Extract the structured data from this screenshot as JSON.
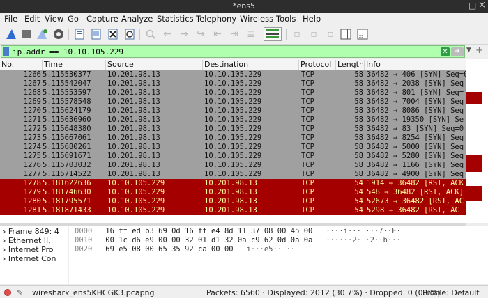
{
  "window": {
    "title": "*ens5",
    "min": "–",
    "max": "□",
    "close": "×"
  },
  "menu": [
    "File",
    "Edit",
    "View",
    "Go",
    "Capture",
    "Analyze",
    "Statistics",
    "Telephony",
    "Wireless",
    "Tools",
    "Help"
  ],
  "filter": {
    "value": "ip.addr == 10.10.105.229"
  },
  "columns": [
    "No.",
    "Time",
    "Source",
    "Destination",
    "Protocol",
    "Length",
    "Info"
  ],
  "packets": [
    {
      "no": "1266",
      "time": "5.115530377",
      "src": "10.201.98.13",
      "dst": "10.10.105.229",
      "proto": "TCP",
      "len": "58",
      "info": "36482 → 406 [SYN] Seq=0",
      "style": "gray"
    },
    {
      "no": "1267",
      "time": "5.115542047",
      "src": "10.201.98.13",
      "dst": "10.10.105.229",
      "proto": "TCP",
      "len": "58",
      "info": "36482 → 2038 [SYN] Seq",
      "style": "gray"
    },
    {
      "no": "1268",
      "time": "5.115553597",
      "src": "10.201.98.13",
      "dst": "10.10.105.229",
      "proto": "TCP",
      "len": "58",
      "info": "36482 → 801 [SYN] Seq=",
      "style": "gray"
    },
    {
      "no": "1269",
      "time": "5.115578548",
      "src": "10.201.98.13",
      "dst": "10.10.105.229",
      "proto": "TCP",
      "len": "58",
      "info": "36482 → 7004 [SYN] Seq",
      "style": "gray"
    },
    {
      "no": "1270",
      "time": "5.115624179",
      "src": "10.201.98.13",
      "dst": "10.10.105.229",
      "proto": "TCP",
      "len": "58",
      "info": "36482 → 8086 [SYN] Seq",
      "style": "gray"
    },
    {
      "no": "1271",
      "time": "5.115636960",
      "src": "10.201.98.13",
      "dst": "10.10.105.229",
      "proto": "TCP",
      "len": "58",
      "info": "36482 → 19350 [SYN] Se",
      "style": "gray"
    },
    {
      "no": "1272",
      "time": "5.115648380",
      "src": "10.201.98.13",
      "dst": "10.10.105.229",
      "proto": "TCP",
      "len": "58",
      "info": "36482 → 83 [SYN] Seq=0",
      "style": "gray"
    },
    {
      "no": "1273",
      "time": "5.115667061",
      "src": "10.201.98.13",
      "dst": "10.10.105.229",
      "proto": "TCP",
      "len": "58",
      "info": "36482 → 8254 [SYN] Seq",
      "style": "gray"
    },
    {
      "no": "1274",
      "time": "5.115680261",
      "src": "10.201.98.13",
      "dst": "10.10.105.229",
      "proto": "TCP",
      "len": "58",
      "info": "36482 → 5000 [SYN] Seq",
      "style": "gray"
    },
    {
      "no": "1275",
      "time": "5.115691671",
      "src": "10.201.98.13",
      "dst": "10.10.105.229",
      "proto": "TCP",
      "len": "58",
      "info": "36482 → 5280 [SYN] Seq",
      "style": "gray"
    },
    {
      "no": "1276",
      "time": "5.115703032",
      "src": "10.201.98.13",
      "dst": "10.10.105.229",
      "proto": "TCP",
      "len": "58",
      "info": "36482 → 1166 [SYN] Seq",
      "style": "gray"
    },
    {
      "no": "1277",
      "time": "5.115714522",
      "src": "10.201.98.13",
      "dst": "10.10.105.229",
      "proto": "TCP",
      "len": "58",
      "info": "36482 → 4900 [SYN] Seq",
      "style": "gray"
    },
    {
      "no": "1278",
      "time": "5.181622636",
      "src": "10.10.105.229",
      "dst": "10.201.98.13",
      "proto": "TCP",
      "len": "54",
      "info": "1914 → 36482 [RST, ACK",
      "style": "red"
    },
    {
      "no": "1279",
      "time": "5.181746630",
      "src": "10.10.105.229",
      "dst": "10.201.98.13",
      "proto": "TCP",
      "len": "54",
      "info": "548 → 36482 [RST, ACK]",
      "style": "red"
    },
    {
      "no": "1280",
      "time": "5.181795571",
      "src": "10.10.105.229",
      "dst": "10.201.98.13",
      "proto": "TCP",
      "len": "54",
      "info": "52673 → 36482 [RST, AC",
      "style": "red"
    },
    {
      "no": "1281",
      "time": "5.181871433",
      "src": "10.10.105.229",
      "dst": "10.201.98.13",
      "proto": "TCP",
      "len": "54",
      "info": "5298 → 36482 [RST, AC",
      "style": "red"
    }
  ],
  "details": [
    "Frame 849: 4",
    "Ethernet II,",
    "Internet Pro",
    "Internet Con"
  ],
  "bytes": [
    {
      "offset": "0000",
      "hex": "16 ff ed b3 69 0d 16 ff  e4 8d 11 37 08 00 45 00",
      "ascii": "····i··· ···7··E·"
    },
    {
      "offset": "0010",
      "hex": "00 1c d6 e9 00 00 32 01  d1 32 0a c9 62 0d 0a 0a",
      "ascii": "······2· ·2··b···"
    },
    {
      "offset": "0020",
      "hex": "69 e5 08 00 65 35 92 ca  00 00",
      "ascii": "i···e5·· ··"
    }
  ],
  "status": {
    "file": "wireshark_ens5KHCGK3.pcapng",
    "packets": "Packets: 6560 · Displayed: 2012 (30.7%) · Dropped: 0 (0.0%)",
    "profile": "Profile: Default"
  },
  "colors": {
    "gray_row": "#a0a0a0",
    "red_row": "#a40000",
    "red_text": "#fffc9c",
    "filter_ok": "#afffaf"
  }
}
